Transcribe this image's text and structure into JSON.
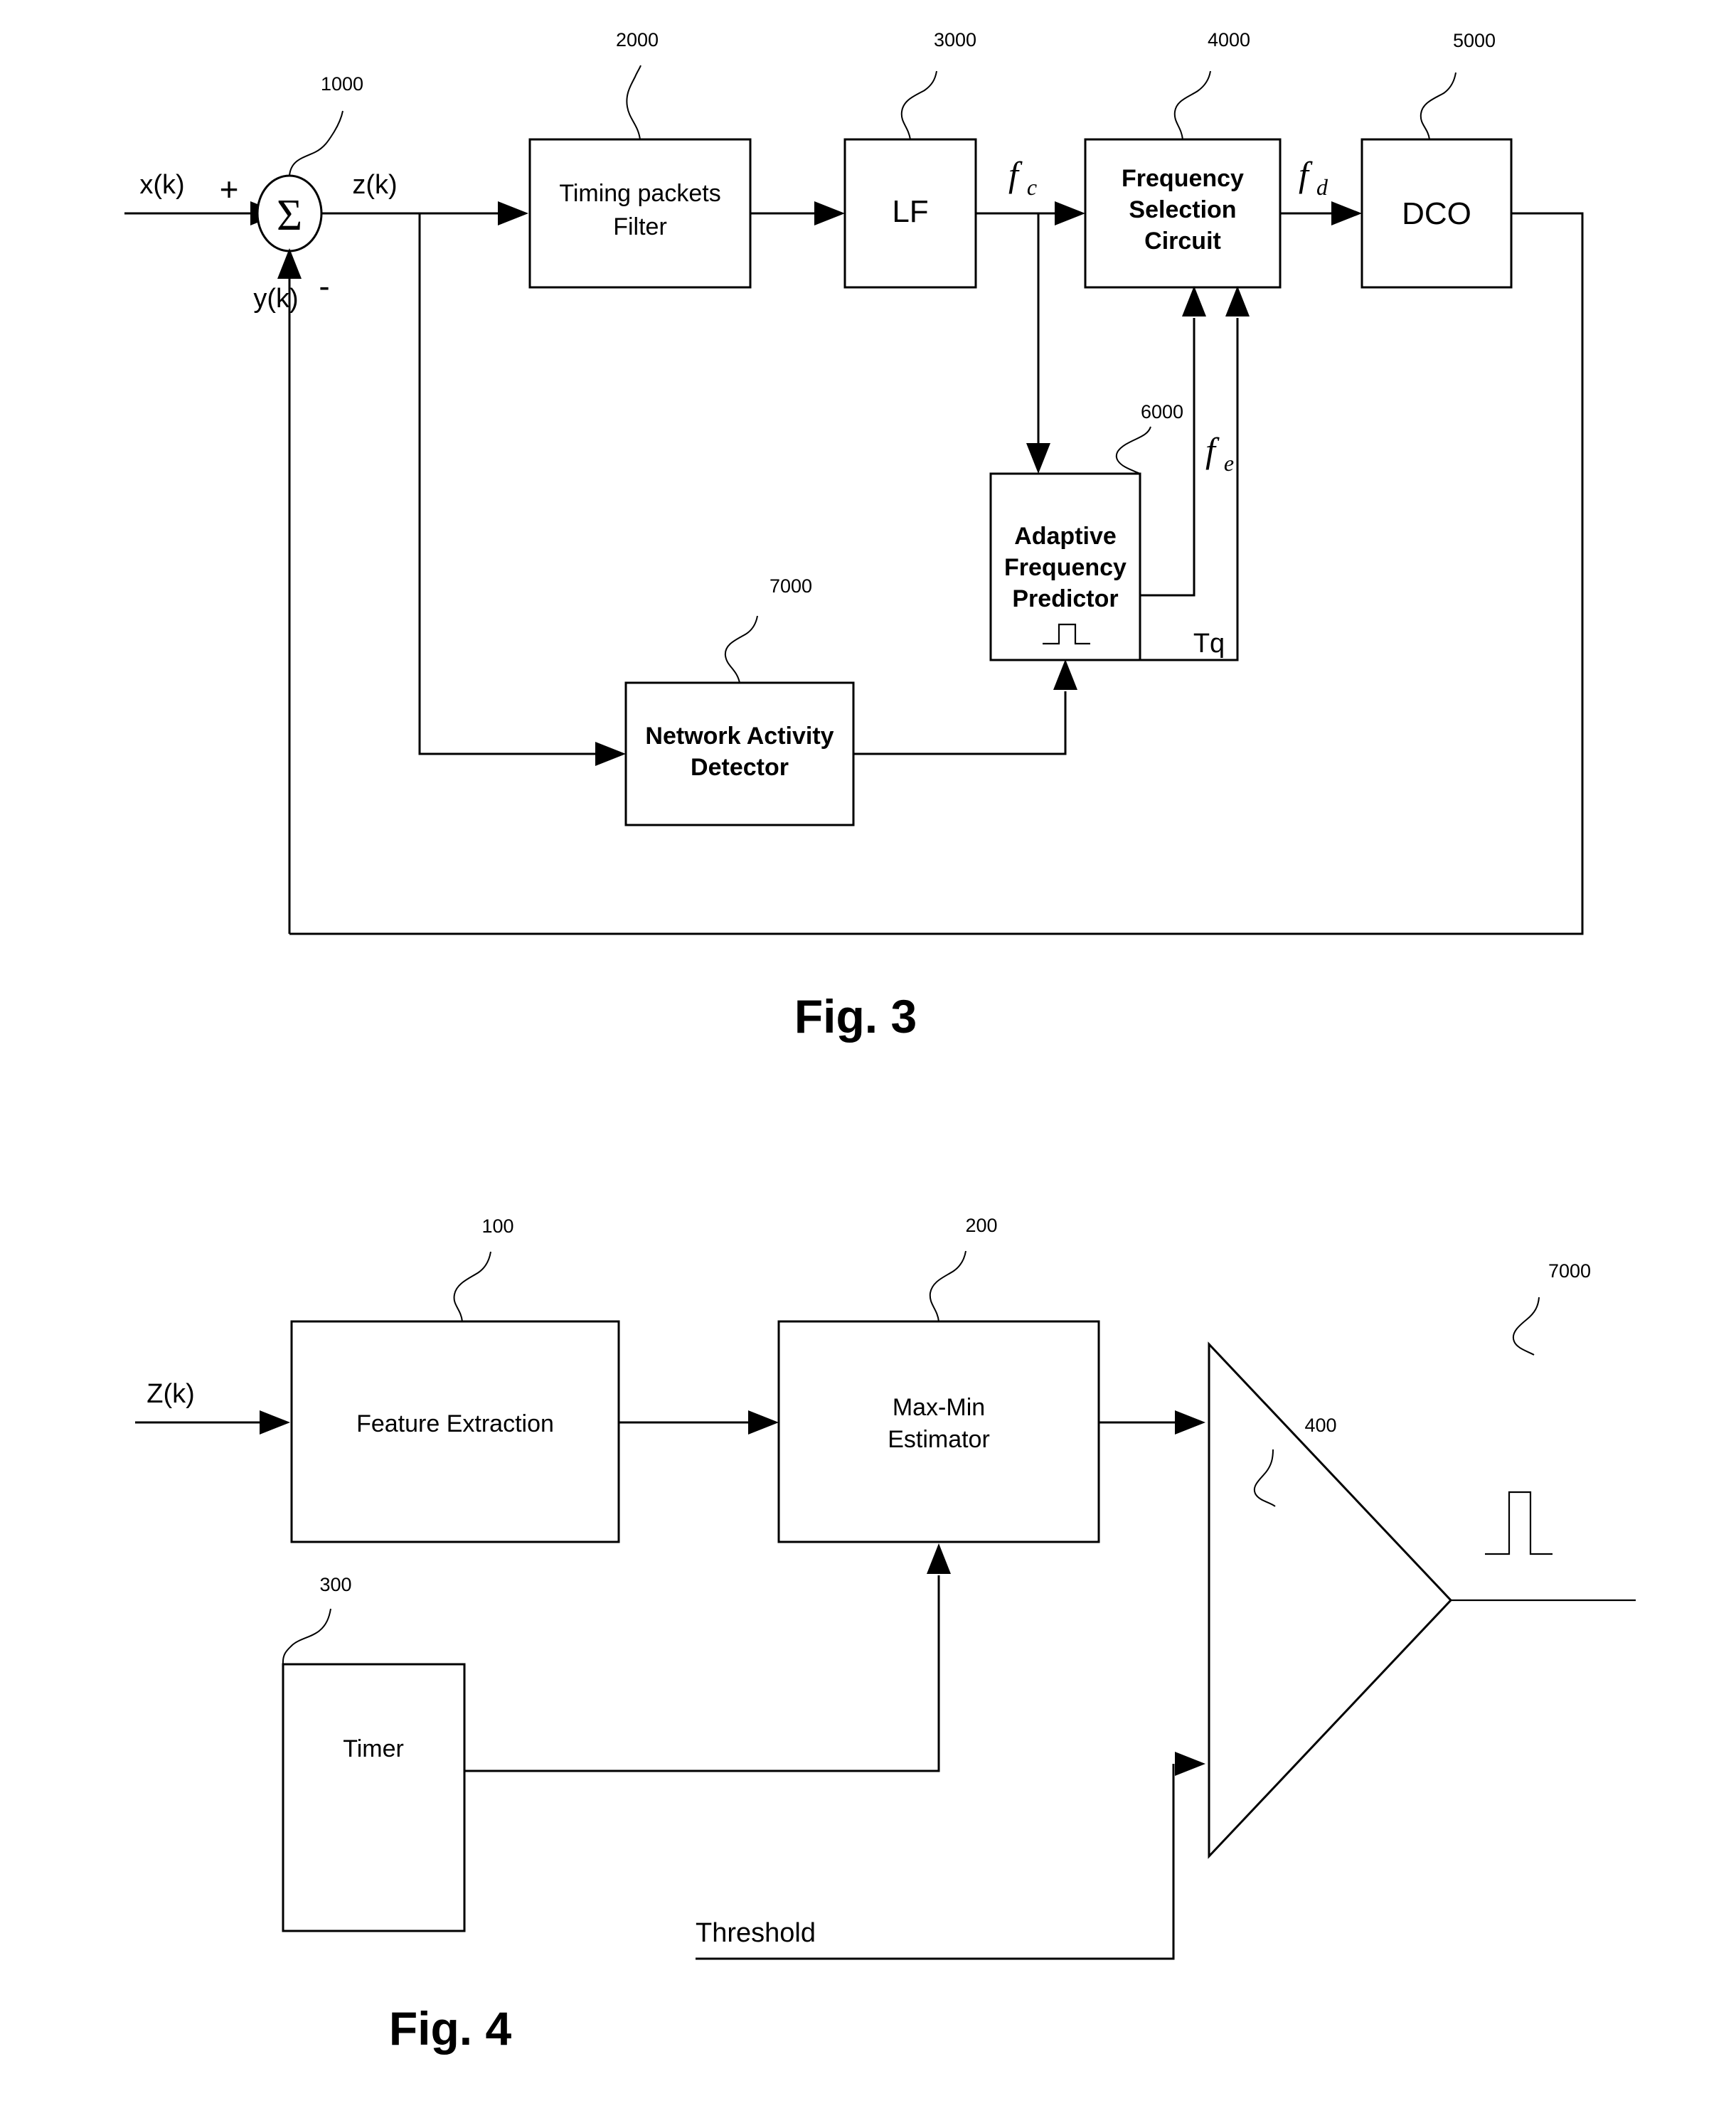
{
  "figures": [
    {
      "caption": "Fig. 3",
      "signals": {
        "input": "x(k)",
        "feedback": "y(k)",
        "error": "z(k)",
        "plus": "+",
        "minus": "-",
        "sum_glyph": "Σ",
        "fc_base": "f",
        "fc_sub": "c",
        "fd_base": "f",
        "fd_sub": "d",
        "fe_base": "f",
        "fe_sub": "e",
        "tq": "Tq"
      },
      "blocks": [
        {
          "id": "summing-junction",
          "label": "",
          "ref": "1000"
        },
        {
          "id": "timing-packets-filter",
          "label_line1": "Timing packets",
          "label_line2": "Filter",
          "ref": "2000"
        },
        {
          "id": "loop-filter",
          "label_line1": "LF",
          "ref": "3000"
        },
        {
          "id": "frequency-selection-circuit",
          "label_line1": "Frequency",
          "label_line2": "Selection",
          "label_line3": "Circuit",
          "ref": "4000"
        },
        {
          "id": "dco",
          "label_line1": "DCO",
          "ref": "5000"
        },
        {
          "id": "adaptive-frequency-predictor",
          "label_line1": "Adaptive",
          "label_line2": "Frequency",
          "label_line3": "Predictor",
          "ref": "6000"
        },
        {
          "id": "network-activity-detector",
          "label_line1": "Network Activity",
          "label_line2": "Detector",
          "ref": "7000"
        }
      ]
    },
    {
      "caption": "Fig. 4",
      "signals": {
        "input": "Z(k)",
        "threshold": "Threshold"
      },
      "blocks": [
        {
          "id": "feature-extraction",
          "label_line1": "Feature Extraction",
          "ref": "100"
        },
        {
          "id": "max-min-estimator",
          "label_line1": "Max-Min",
          "label_line2": "Estimator",
          "ref": "200"
        },
        {
          "id": "timer",
          "label_line1": "Timer",
          "ref": "300"
        },
        {
          "id": "comparator",
          "label_line1": "",
          "ref": "400"
        },
        {
          "id": "network-activity-detector-assembly",
          "label_line1": "",
          "ref": "7000"
        }
      ]
    }
  ],
  "colors": {
    "stroke": "#000000",
    "fill": "#ffffff"
  }
}
